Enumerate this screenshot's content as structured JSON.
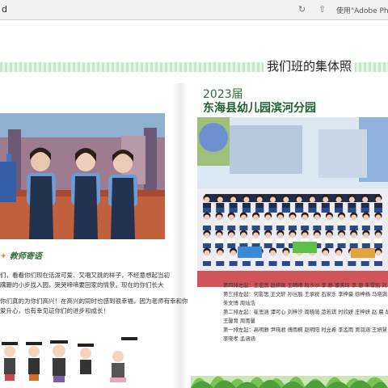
{
  "window": {
    "title": "d",
    "adobe_label": "使用\"Adobe Pho"
  },
  "page": {
    "section_title": "我们班的集体照",
    "class_photo": {
      "year": "2023届",
      "school": "东海县幼儿园滨河分园"
    },
    "teacher_words_title": "教师寄语",
    "teacher_words_lines": [
      "们，看看你们现在活泼可爱、又唱又跳的样子，不经意想起当初",
      "蹒跚的小步找入园，哭哭啼啼要回家的情景。现在的你们长大",
      "你们真的为你们高兴！在高兴的同时也感到很幸福，因为老师有幸和你",
      "爱升心，也有幸见证你们的进步和成长！"
    ],
    "name_rows": [
      "第四排左起：王宏宽  赵妍颖  王晴晴  段沙沙  李  静  董美玲  李  恩  朱雪凯  刘",
      "第三排左起：何影思  王文轩  孙岂辰  王承锐  石家乐  李梓豪  徐梓杨  马晓满  范",
      "                   朱文博  周灿浩",
      "第二排左起：崔思涵  谭可心  刘梓汐  周晓萌  范若琪  时欣妍  庄梓妍  赵  晨  胡",
      "                   王馨育  周雨馨",
      "第一排左起：高明雅  尹晓君  傅雨桐  赵明阳  时允希  李孟雨  贾羽涵  王妍慧  王",
      "                   李晓孝  孟涵涵"
    ]
  }
}
